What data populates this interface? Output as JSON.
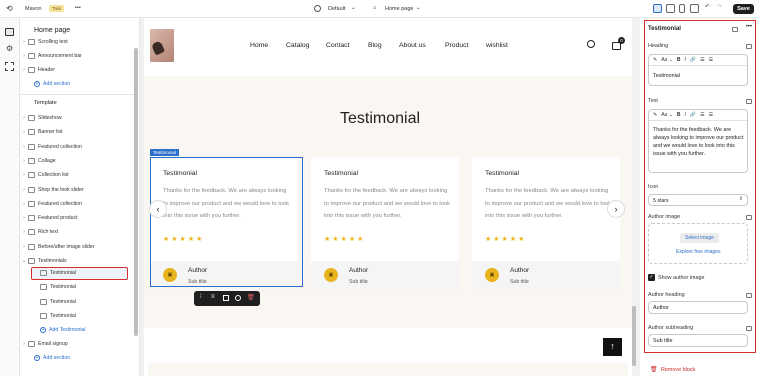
{
  "topbar": {
    "store_name": "Mavon",
    "trial_badge": "Trial",
    "more": "•••",
    "theme_selector": "Default",
    "page_selector": "Home page",
    "save_label": "Save"
  },
  "sidebar": {
    "title": "Home page",
    "header_items": [
      {
        "label": "Scrolling text"
      },
      {
        "label": "Announcement bar"
      },
      {
        "label": "Header"
      }
    ],
    "add_section_header": "Add section",
    "template_label": "Template",
    "template_items": [
      {
        "label": "Slideshow"
      },
      {
        "label": "Banner list"
      },
      {
        "label": "Featured collection"
      },
      {
        "label": "Collage"
      },
      {
        "label": "Collection list"
      },
      {
        "label": "Shop the look slider"
      },
      {
        "label": "Featured collection"
      },
      {
        "label": "Featured product"
      },
      {
        "label": "Rich text"
      },
      {
        "label": "Before/after image slider"
      },
      {
        "label": "Testimonials"
      }
    ],
    "testimonial_children": [
      {
        "label": "Testimonial"
      },
      {
        "label": "Testimonial"
      },
      {
        "label": "Testimonial"
      },
      {
        "label": "Testimonial"
      }
    ],
    "add_testimonial": "Add Testimonial",
    "email_signup": "Email signup",
    "add_section_template": "Add section"
  },
  "preview": {
    "nav": [
      "Home",
      "Catalog",
      "Contact",
      "Blog",
      "About us",
      "Product",
      "wishlist"
    ],
    "cart_count": "0",
    "section_title": "Testimonial",
    "selected_tag": "Testimonial",
    "cards": [
      {
        "title": "Testimonial",
        "body": "Thanks for the feedback. We are always looking to improve our product and we would love to look into this issue with you further.",
        "stars": "★★★★★",
        "author": "Author",
        "subtitle": "Sub title"
      },
      {
        "title": "Testimonial",
        "body": "Thanks for the feedback. We are always looking to improve our product and we would love to look into this issue with you further.",
        "stars": "★★★★★",
        "author": "Author",
        "subtitle": "Sub title"
      },
      {
        "title": "Testimonial",
        "body": "Thanks for the feedback. We are always looking to improve our product and we would love to look into this issue with you further.",
        "stars": "★★★★★",
        "author": "Author",
        "subtitle": "Sub title"
      }
    ]
  },
  "panel": {
    "title": "Testimonial",
    "heading_label": "Heading",
    "heading_value": "Testimonial",
    "text_label": "Text",
    "text_value": "Thanks for the feedback. We are always looking to improve our product and we would love to look into this issue with you further.",
    "icon_label": "Icon",
    "icon_value": "5 stars",
    "author_image_label": "Author image",
    "select_image": "Select image",
    "explore_images": "Explore free images",
    "show_author_image": "Show author image",
    "author_heading_label": "Author heading",
    "author_heading_value": "Author",
    "author_subheading_label": "Author subheading",
    "author_subheading_value": "Sub title",
    "remove_block": "Remove block"
  },
  "colors": {
    "accent": "#2c6ecb",
    "highlight_red": "#d62d2d",
    "star": "#f0b21e",
    "avatar": "#e9b320",
    "save_bg": "#1e1e1e"
  }
}
